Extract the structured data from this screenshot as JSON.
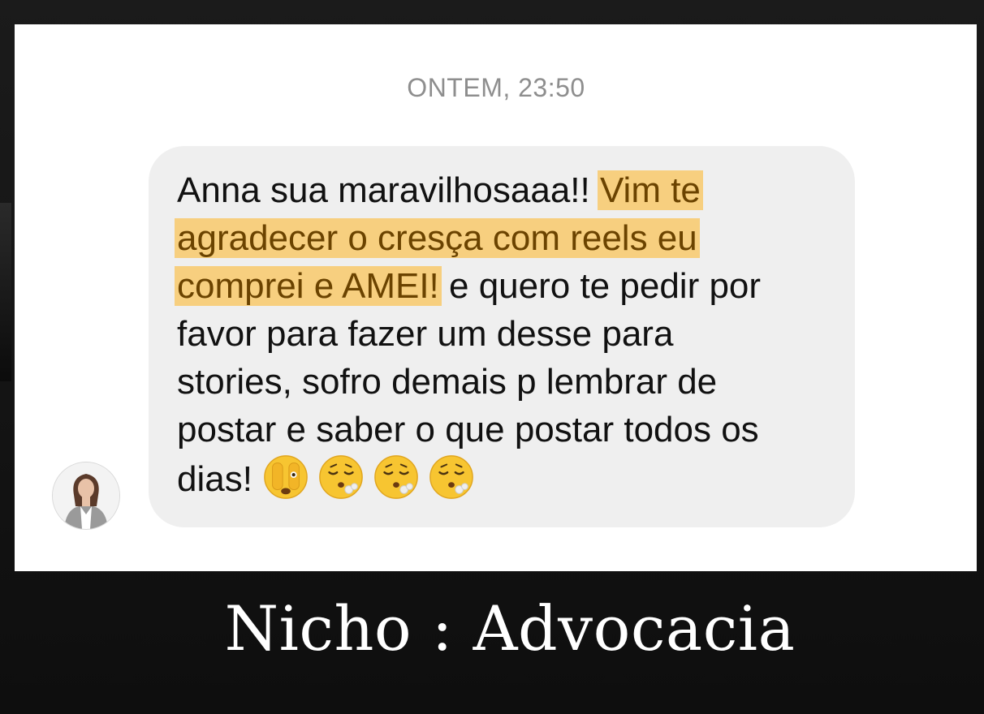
{
  "chat": {
    "timestamp": "ONTEM, 23:50",
    "message": {
      "part1": "Anna sua maravilhosaaa!! ",
      "highlight1": "Vim te",
      "highlight2": "agradecer o cresça com reels eu",
      "highlight3": "comprei e AMEI!",
      "part2": " e quero te pedir por",
      "line4": "favor para fazer um desse para",
      "line5": "stories, sofro demais p lembrar de",
      "line6": "postar e saber o que postar todos os",
      "line7_text": "dias! ",
      "emojis": [
        "face-with-peeking-eye-icon",
        "face-exhaling-icon",
        "face-exhaling-icon",
        "face-exhaling-icon"
      ]
    },
    "highlight_color": "#f9c45a"
  },
  "caption": {
    "text": "Nicho : Advocacia"
  }
}
